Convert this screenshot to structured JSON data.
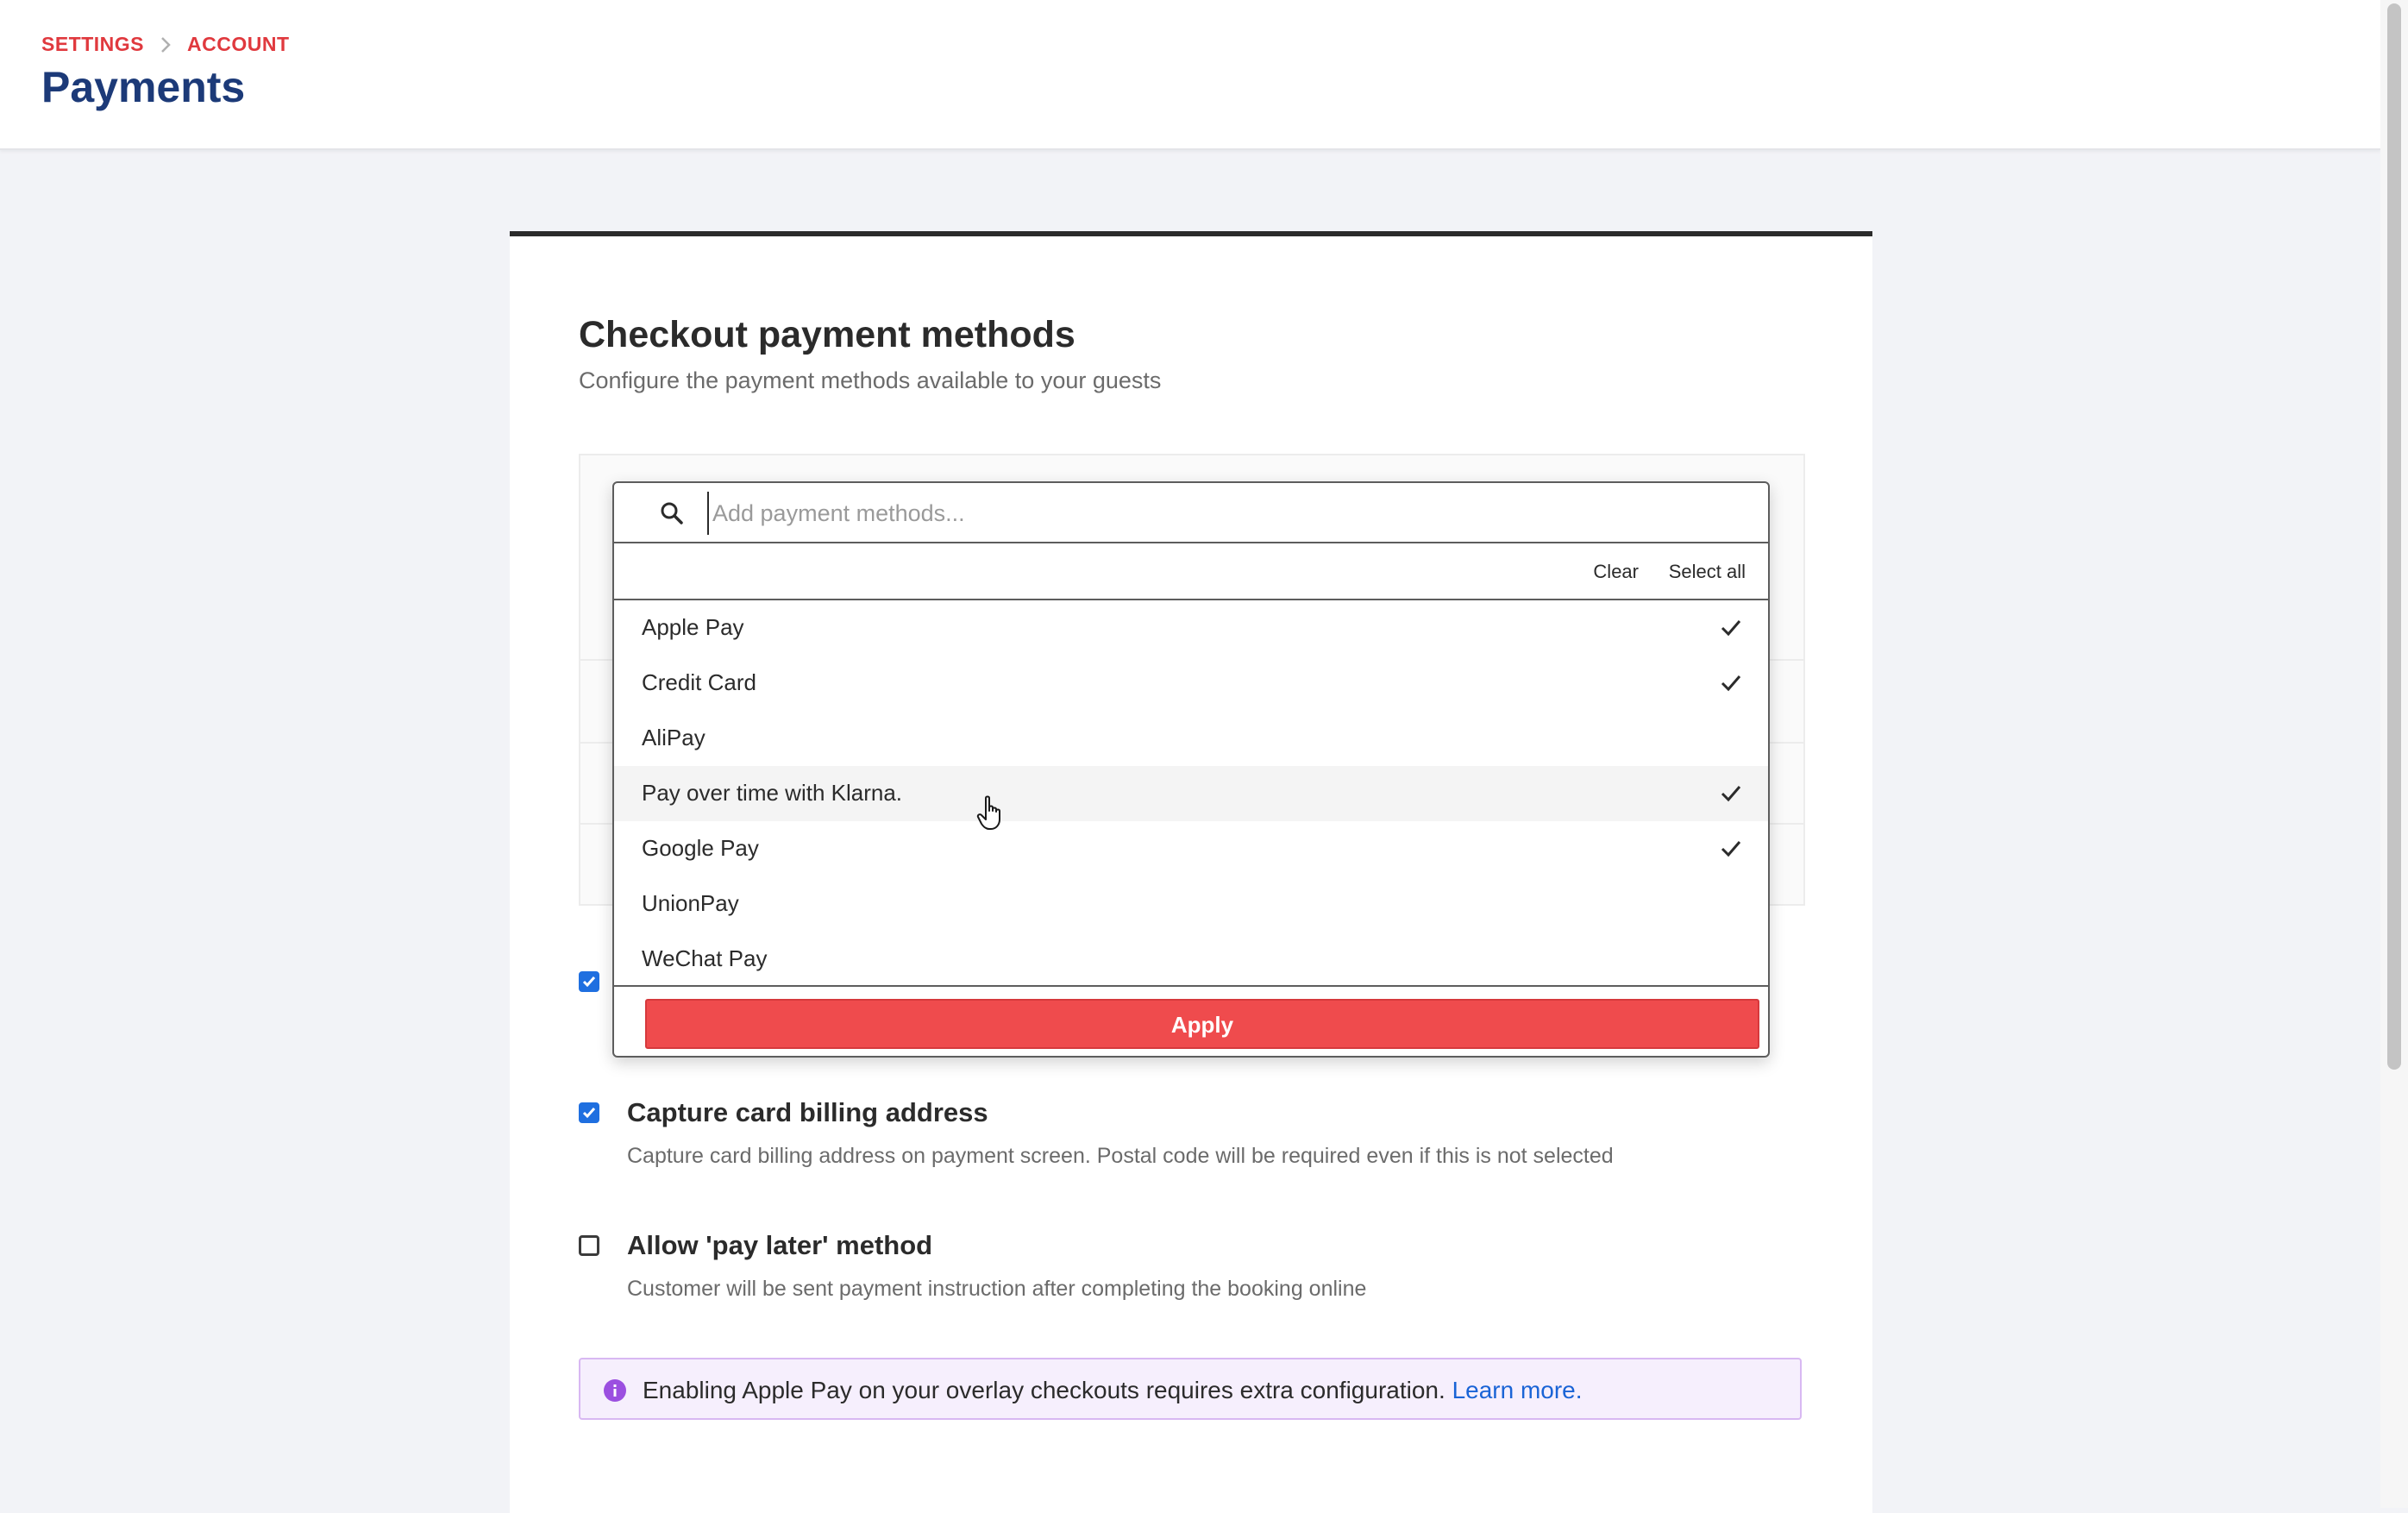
{
  "header": {
    "breadcrumb": [
      "SETTINGS",
      "ACCOUNT"
    ],
    "title": "Payments"
  },
  "card": {
    "title": "Checkout payment methods",
    "subtitle": "Configure the payment methods available to your guests"
  },
  "dropdown": {
    "search_placeholder": "Add payment methods...",
    "search_value": "",
    "clear_label": "Clear",
    "select_all_label": "Select all",
    "items": [
      {
        "label": "Apple Pay",
        "checked": true
      },
      {
        "label": "Credit Card",
        "checked": true
      },
      {
        "label": "AliPay",
        "checked": false
      },
      {
        "label": "Pay over time with Klarna.",
        "checked": true,
        "hovered": true
      },
      {
        "label": "Google Pay",
        "checked": true
      },
      {
        "label": "UnionPay",
        "checked": false
      },
      {
        "label": "WeChat Pay",
        "checked": false
      }
    ],
    "apply_label": "Apply"
  },
  "options": {
    "hidden_option": {
      "checked": true
    },
    "capture_billing": {
      "checked": true,
      "title": "Capture card billing address",
      "description": "Capture card billing address on payment screen. Postal code will be required even if this is not selected"
    },
    "pay_later": {
      "checked": false,
      "title": "Allow 'pay later' method",
      "description": "Customer will be sent payment instruction after completing the booking online"
    }
  },
  "info": {
    "text": "Enabling Apple Pay on your overlay checkouts requires extra configuration.",
    "link": "Learn more."
  },
  "colors": {
    "accent_red": "#ef4b4d",
    "title_blue": "#1c3a78",
    "checkbox_blue": "#1f6fe0",
    "link_blue": "#1a64d6",
    "info_bg": "#f6effd"
  }
}
